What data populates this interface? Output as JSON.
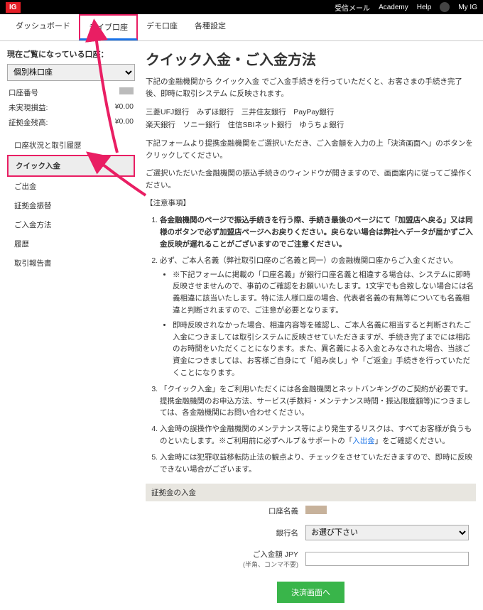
{
  "topbar": {
    "logo": "IG",
    "links": [
      "受信メール",
      "Academy",
      "Help"
    ],
    "user": "My IG"
  },
  "nav": {
    "items": [
      "ダッシュボード",
      "ライブ口座",
      "デモ口座",
      "各種設定"
    ],
    "active_index": 1
  },
  "sidebar": {
    "title": "現在ご覧になっている口座：",
    "select_value": "個別株口座",
    "rows": [
      {
        "label": "口座番号",
        "masked": true
      },
      {
        "label": "未実現損益:",
        "value": "¥0.00"
      },
      {
        "label": "証拠金残高:",
        "value": "¥0.00"
      }
    ],
    "menu": [
      "口座状況と取引履歴",
      "クイック入金",
      "ご出金",
      "証拠金振替",
      "ご入金方法",
      "履歴",
      "取引報告書"
    ],
    "menu_highlight_index": 1
  },
  "main": {
    "title": "クイック入金・ご入金方法",
    "intro1": "下記の金融機関から クイック入金 でご入金手続きを行っていただくと、お客さまの手続き完了後、即時に取引システム に反映されます。",
    "banks_line1": "三菱UFJ銀行　みずほ銀行　三井住友銀行　PayPay銀行",
    "banks_line2": "楽天銀行　ソニー銀行　住信SBIネット銀行　ゆうちょ銀行",
    "intro2": "下記フォームより提携金融機関をご選択いただき、ご入金額を入力の上「決済画面へ」のボタンをクリックしてください。",
    "intro3": "ご選択いただいた金融機関の振込手続きのウィンドウが開きますので、画面案内に従ってご操作ください。",
    "notes_title": "【注意事項】",
    "notes": [
      {
        "text_html": "<b>各金融機関のページで振込手続きを行う際、手続き最後のページにて「加盟店へ戻る」又は同様のボタンで必ず加盟店ページへお戻りください。戻らない場合は弊社へデータが届かずご入金反映が遅れることがございますのでご注意ください。</b>"
      },
      {
        "text": "必ず、ご本人名義（弊社取引口座のご名義と同一）の金融機関口座からご入金ください。",
        "sub": [
          "※下記フォームに掲載の「口座名義」が銀行口座名義と相違する場合は、システムに即時反映させませんので、事前のご確認をお願いいたします。1文字でも合致しない場合には名義相違に該当いたします。特に法人様口座の場合、代表者名義の有無等についても名義相違と判断されますので、ご注意が必要となります。",
          "即時反映されなかった場合、相違内容等を確認し、ご本人名義に相当すると判断されたご入金につきましては取引システムに反映させていただきますが、手続き完了までには相応のお時間をいただくことになります。また、異名義による入金とみなされた場合、当該ご資金につきましては、お客様ご自身にて「組み戻し」や「ご返金」手続きを行っていただくことになります。"
        ]
      },
      {
        "text": "「クイック入金」をご利用いただくには各金融機関とネットバンキングのご契約が必要です。提携金融機関のお申込方法、サービス(手数料・メンテナンス時間・振込限度額等)につきましては、各金融機関にお問い合わせください。"
      },
      {
        "text_html": "入金時の誤操作や金融機関のメンテナンス等により発生するリスクは、すべてお客様が負うものといたします。※ご利用前に必ずヘルプ＆サポートの「<span class='link'>入出金</span>」をご確認ください。"
      },
      {
        "text": "入金時には犯罪収益移転防止法の観点より、チェックをさせていただきますので、即時に反映できない場合がございます。"
      }
    ],
    "deposit_section": "証拠金の入金",
    "form": {
      "account_name_label": "口座名義",
      "bank_label": "銀行名",
      "bank_placeholder": "お選び下さい",
      "amount_label": "ご入金額 JPY",
      "amount_sublabel": "(半角、コンマ不要)",
      "submit": "決済画面へ"
    }
  }
}
